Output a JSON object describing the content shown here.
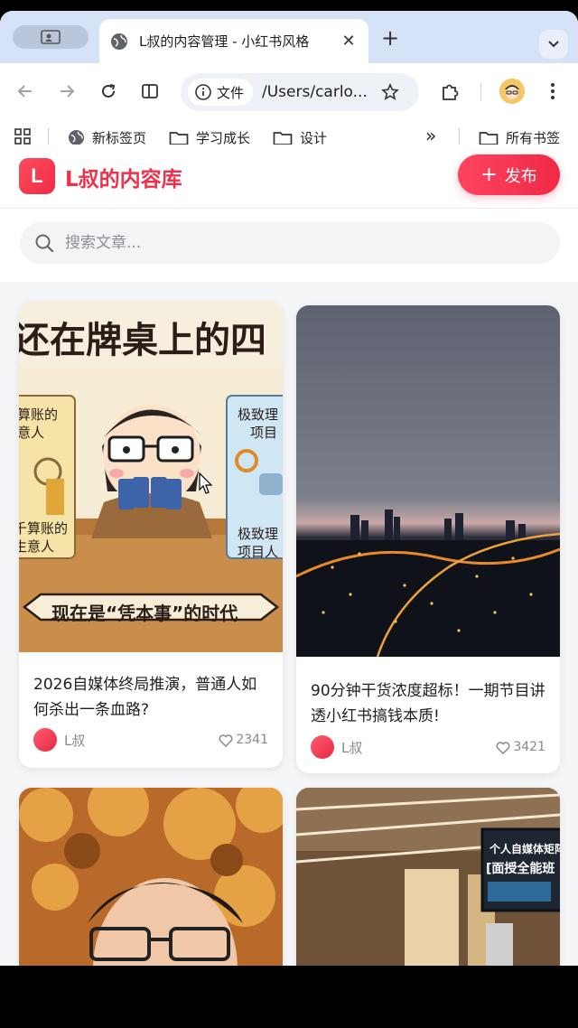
{
  "browser": {
    "tab_title": "L叔的内容管理 - 小红书风格",
    "site_chip": "文件",
    "url": "/Users/carlo...",
    "bookmarks": {
      "new_tab": "新标签页",
      "learning": "学习成长",
      "design": "设计",
      "overflow": "»",
      "all": "所有书签"
    }
  },
  "app": {
    "logo_letter": "L",
    "brand": "L叔的内容库",
    "publish_label": "发布",
    "publish_icon": "+",
    "search_placeholder": "搜索文章..."
  },
  "cards": [
    {
      "title": "2026自媒体终局推演，普通人如何杀出一条血路?",
      "author": "L叔",
      "likes": "2341",
      "image": {
        "banner": "还在牌桌上的四",
        "left_sign_1": "算账的",
        "left_sign_2": "意人",
        "left_sign_3": "千算账的",
        "left_sign_4": "生意人",
        "right_sign_1": "极致理",
        "right_sign_2": "项目",
        "right_sign_3": "极致理",
        "right_sign_4": "项目人",
        "ribbon": "现在是“凭本事”的时代"
      }
    },
    {
      "title": "90分钟干货浓度超标！一期节目讲透小红书搞钱本质!",
      "author": "L叔",
      "likes": "3421"
    },
    {
      "title": "",
      "author": "",
      "likes": ""
    },
    {
      "title": "",
      "author": "",
      "likes": "",
      "image": {
        "screen_line_1": "个人自媒体矩阵",
        "screen_line_2": "[面授全能班"
      }
    }
  ],
  "colors": {
    "brand_red": "#f0304a",
    "tab_strip": "#d6e2f7"
  }
}
